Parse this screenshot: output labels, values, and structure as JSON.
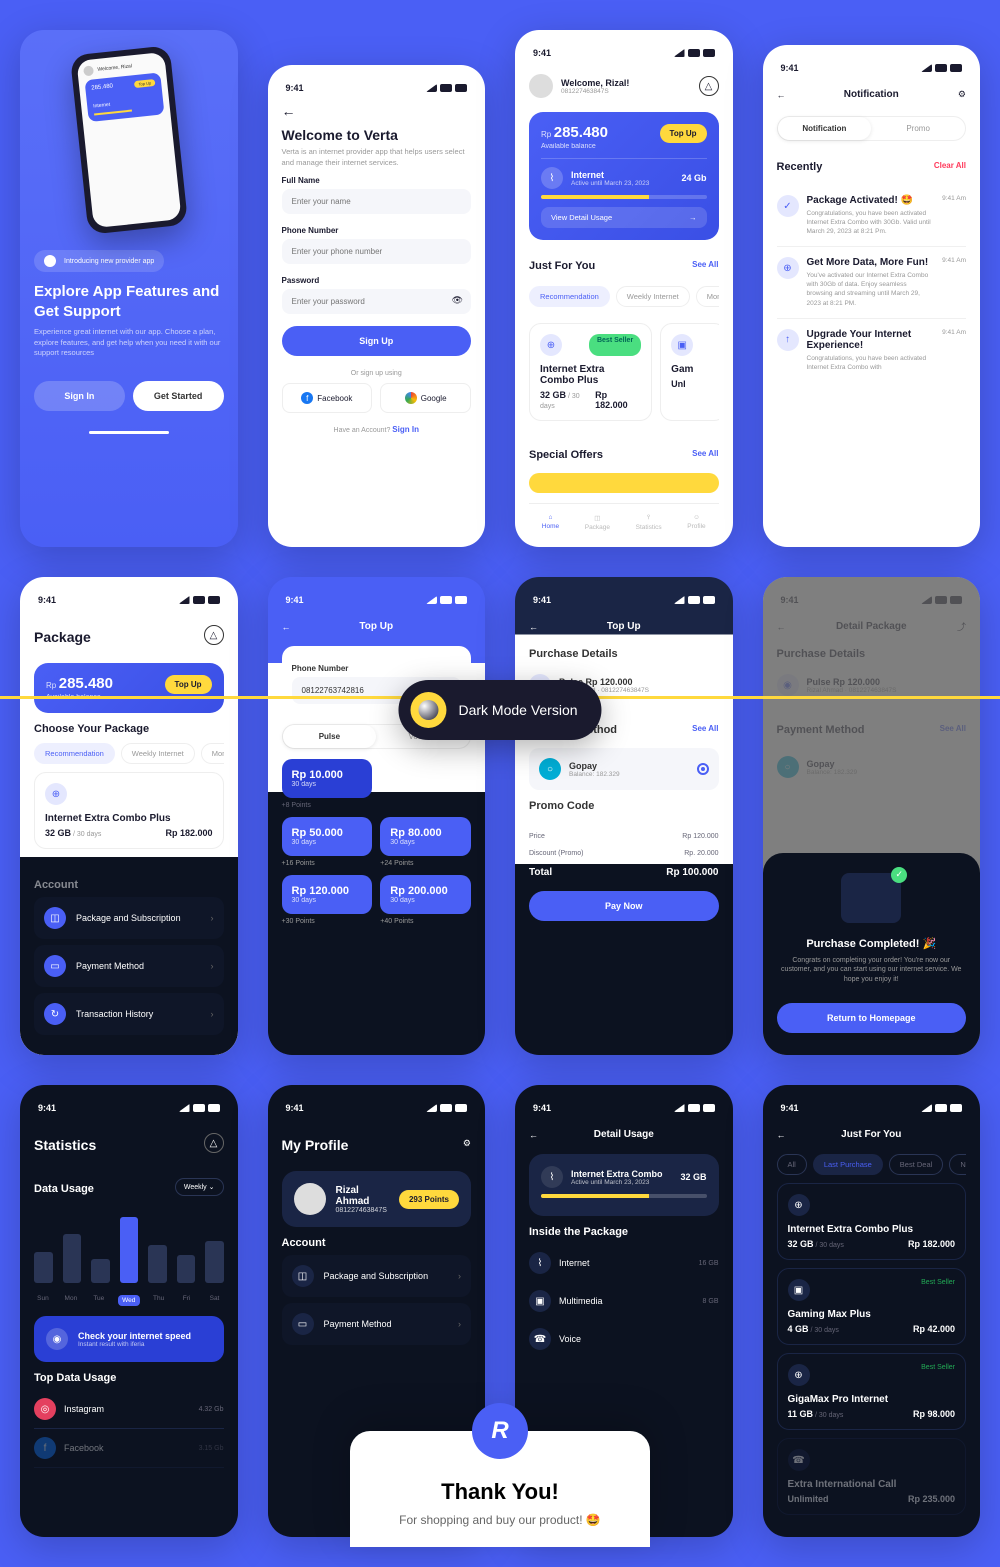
{
  "statusTime": "9:41",
  "darkModeLabel": "Dark Mode Version",
  "thankYou": {
    "title": "Thank You!",
    "subtitle": "For shopping and buy our product! 🤩"
  },
  "s1": {
    "banner": "Introducing new provider app",
    "title": "Explore App Features and Get Support",
    "desc": "Experience great internet with our app. Choose a plan, explore features, and get help when you need it with our support resources",
    "signIn": "Sign In",
    "getStarted": "Get Started"
  },
  "s2": {
    "title": "Welcome to Verta",
    "desc": "Verta is an internet provider app that helps users select and manage their internet services.",
    "fullName": "Full Name",
    "fullNamePh": "Enter your name",
    "phone": "Phone Number",
    "phonePh": "Enter your phone number",
    "password": "Password",
    "passwordPh": "Enter your password",
    "signUp": "Sign Up",
    "orSignUp": "Or sign up using",
    "facebook": "Facebook",
    "google": "Google",
    "haveAccount": "Have an Account? ",
    "signIn": "Sign In"
  },
  "s3": {
    "welcome": "Welcome, Rizal!",
    "phone": "081227463847S",
    "balLabel": "Rp",
    "balAmount": "285.480",
    "balSub": "Available balance",
    "topUp": "Top Up",
    "internet": "Internet",
    "activeUntil": "Active until March 23, 2023",
    "internetVal": "24 Gb",
    "viewDetail": "View Detail Usage",
    "justForYou": "Just For You",
    "seeAll": "See All",
    "tab1": "Recommendation",
    "tab2": "Weekly Internet",
    "tab3": "Monthly Internet",
    "bestSeller": "Best Seller",
    "pkgName": "Internet Extra Combo Plus",
    "pkgSize": "32 GB",
    "pkgDays": " / 30 days",
    "pkgPrice": "Rp 182.000",
    "pkg2Name": "Gam",
    "pkg2Price": "Unl",
    "specialOffers": "Special Offers",
    "navHome": "Home",
    "navPackage": "Package",
    "navStats": "Statistics",
    "navProfile": "Profile"
  },
  "s4": {
    "title": "Notification",
    "tab1": "Notification",
    "tab2": "Promo",
    "recently": "Recently",
    "clearAll": "Clear All",
    "n1t": "Package Activated! 🤩",
    "n1d": "Congratulations, you have been activated Internet Extra Combo with 30Gb. Valid until March 29, 2023 at 8:21 Pm.",
    "n1time": "9:41 Am",
    "n2t": "Get More Data, More Fun!",
    "n2d": "You've activated our Internet Extra Combo with 30Gb of data. Enjoy seamless browsing and streaming until March 29, 2023 at 8:21 PM.",
    "n2time": "9:41 Am",
    "n3t": "Upgrade Your Internet Experience!",
    "n3d": "Congratulations, you have been activated Internet Extra Combo with",
    "n3time": "9:41 Am"
  },
  "s5": {
    "title": "Package",
    "balLabel": "Rp",
    "balAmount": "285.480",
    "balSub": "Available balance",
    "topUp": "Top Up",
    "choose": "Choose Your Package",
    "tab1": "Recommendation",
    "tab2": "Weekly Internet",
    "tab3": "Monthly Internet",
    "pkgName": "Internet Extra Combo Plus",
    "pkgSize": "32 GB",
    "pkgDays": " / 30 days",
    "pkgPrice": "Rp 182.000",
    "account": "Account",
    "item1": "Package and Subscription",
    "item2": "Payment Method",
    "item3": "Transaction History"
  },
  "s6": {
    "title": "Top Up",
    "phone": "Phone Number",
    "phoneVal": "0812276374281​6",
    "tabPulse": "Pulse",
    "tabVoucher": "Voucher",
    "a1": "Rp 10.000",
    "d1": "30 days",
    "p1": "+8 Points",
    "a2": "Rp 50.000",
    "d2": "30 days",
    "p2": "+16 Points",
    "a3": "Rp 80.000",
    "d3": "30 days",
    "p3": "+24 Points",
    "a4": "Rp 120.000",
    "d4": "30 days",
    "p4": "+30 Points",
    "a5": "Rp 200.000",
    "d5": "30 days",
    "p5": "+40 Points"
  },
  "s7": {
    "title": "Top Up",
    "purchDetails": "Purchase Details",
    "pulseItem": "Pulse Rp 120.000",
    "pulseUser": "Rizal Ahmad",
    "pulsePhone": "081227463847S",
    "payMethod": "Payment Method",
    "seeAll": "See All",
    "gopay": "Gopay",
    "gopayBal": "Balance: 182.329",
    "promo": "Promo Code",
    "price": "Price",
    "priceVal": "Rp 120.000",
    "discount": "Discount (Promo)",
    "discountVal": "Rp. 20.000",
    "total": "Total",
    "totalVal": "Rp 100.000",
    "payNow": "Pay Now"
  },
  "s8": {
    "title": "Detail Package",
    "purchDetails": "Purchase Details",
    "pulseItem": "Pulse Rp 120.000",
    "pulseUser": "Rizal Ahmad",
    "pulsePhone": "081227463847S",
    "payMethod": "Payment Method",
    "seeAll": "See All",
    "gopay": "Gopay",
    "gopayBal": "Balance: 182.329",
    "completed": "Purchase Completed! 🎉",
    "completedDesc": "Congrats on completing your order! You're now our customer, and you can start using our internet service. We hope you enjoy it!",
    "return": "Return to Homepage"
  },
  "s9": {
    "title": "Statistics",
    "dataUsage": "Data Usage",
    "weekly": "Weekly ⌄",
    "days": [
      "Sun",
      "Mon",
      "Tue",
      "Wed",
      "Thu",
      "Fri",
      "Sat"
    ],
    "check": "Check your internet speed",
    "checkSub": "Instant result with iferia",
    "topUsage": "Top Data Usage",
    "app1": "Instagram",
    "app1v": "4.32 Gb",
    "app2": "Facebook",
    "app2v": "3.15 Gb"
  },
  "s10": {
    "title": "My Profile",
    "name": "Rizal Ahmad",
    "phone": "081227463847S",
    "points": "293 Points",
    "account": "Account",
    "item1": "Package and Subscription",
    "item2": "Payment Method"
  },
  "s11": {
    "title": "Detail Usage",
    "pkgName": "Internet Extra Combo",
    "activeUntil": "Active until March 23, 2023",
    "pkgVal": "32 GB",
    "inside": "Inside the Package",
    "i1": "Internet",
    "i1v": "16 GB",
    "i2": "Multimedia",
    "i2v": "8 GB",
    "i3": "Voice",
    "i3v": ""
  },
  "s12": {
    "title": "Just For You",
    "tAll": "All",
    "tLast": "Last Purchase",
    "tBest": "Best Deal",
    "tNight": "Night Internet Pac",
    "p1n": "Internet Extra Combo Plus",
    "p1s": "32 GB",
    "p1d": " / 30 days",
    "p1p": "Rp 182.000",
    "p2n": "Gaming Max Plus",
    "p2s": "4 GB",
    "p2d": " / 30 days",
    "p2p": "Rp 42.000",
    "p2b": "Best Seller",
    "p3n": "GigaMax Pro Internet",
    "p3s": "11 GB",
    "p3d": " / 30 days",
    "p3p": "Rp 98.000",
    "p3b": "Best Seller",
    "p4n": "Extra International Call",
    "p4s": "Unlimited",
    "p4p": "Rp 235.000"
  },
  "chart_data": {
    "type": "bar",
    "categories": [
      "Sun",
      "Mon",
      "Tue",
      "Wed",
      "Thu",
      "Fri",
      "Sat"
    ],
    "values": [
      45,
      70,
      35,
      95,
      55,
      40,
      60
    ],
    "highlight_index": 3,
    "title": "Data Usage",
    "period": "Weekly"
  }
}
